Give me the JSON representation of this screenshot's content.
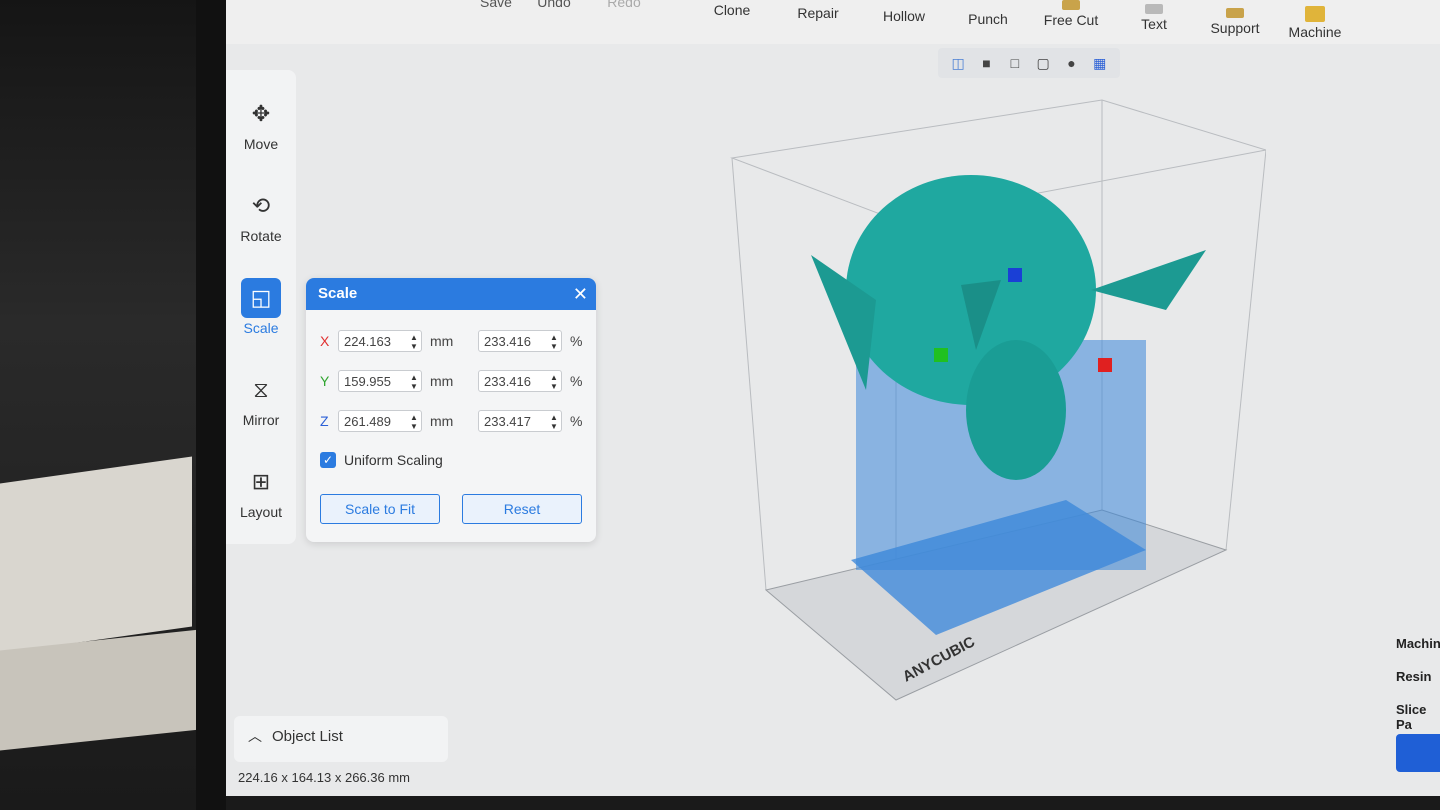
{
  "toolbar": {
    "items": [
      {
        "label": "Save",
        "icon": "save-icon"
      },
      {
        "label": "Undo",
        "icon": "undo-icon"
      },
      {
        "label": "Redo",
        "icon": "redo-icon",
        "disabled": true
      },
      {
        "label": "Clone",
        "icon": "clone-icon"
      },
      {
        "label": "Repair",
        "icon": "repair-icon"
      },
      {
        "label": "Hollow",
        "icon": "hollow-icon"
      },
      {
        "label": "Punch",
        "icon": "punch-icon"
      },
      {
        "label": "Free Cut",
        "icon": "free-cut-icon"
      },
      {
        "label": "Text",
        "icon": "text-icon"
      },
      {
        "label": "Support",
        "icon": "support-icon"
      },
      {
        "label": "Machine",
        "icon": "machine-icon"
      }
    ]
  },
  "view_icons": [
    "cube-wire-icon",
    "cube-solid-icon",
    "cube-outline-icon",
    "frame-icon",
    "sphere-icon",
    "layers-icon"
  ],
  "tools": [
    {
      "label": "Move",
      "icon": "move-icon",
      "active": false
    },
    {
      "label": "Rotate",
      "icon": "rotate-icon",
      "active": false
    },
    {
      "label": "Scale",
      "icon": "scale-icon",
      "active": true
    },
    {
      "label": "Mirror",
      "icon": "mirror-icon",
      "active": false
    },
    {
      "label": "Layout",
      "icon": "layout-icon",
      "active": false
    }
  ],
  "scale_panel": {
    "title": "Scale",
    "x": {
      "axis": "X",
      "mm": "224.163",
      "unit_mm": "mm",
      "pct": "233.416",
      "unit_pct": "%",
      "color": "#e03030"
    },
    "y": {
      "axis": "Y",
      "mm": "159.955",
      "unit_mm": "mm",
      "pct": "233.416",
      "unit_pct": "%",
      "color": "#2fa52f"
    },
    "z": {
      "axis": "Z",
      "mm": "261.489",
      "unit_mm": "mm",
      "pct": "233.417",
      "unit_pct": "%",
      "color": "#2b60d6"
    },
    "uniform_label": "Uniform Scaling",
    "uniform_checked": true,
    "scale_to_fit": "Scale to Fit",
    "reset": "Reset"
  },
  "object_list": {
    "label": "Object List"
  },
  "dimensions": "224.16 x 164.13 x 266.36 mm",
  "brand": "ANYCUBIC",
  "right_panel": {
    "machine": "Machin",
    "resin": "Resin",
    "slice": "Slice Pa"
  },
  "colors": {
    "accent": "#2b7be0",
    "model": "#1fa8a0",
    "supports": "#3a86d9"
  }
}
